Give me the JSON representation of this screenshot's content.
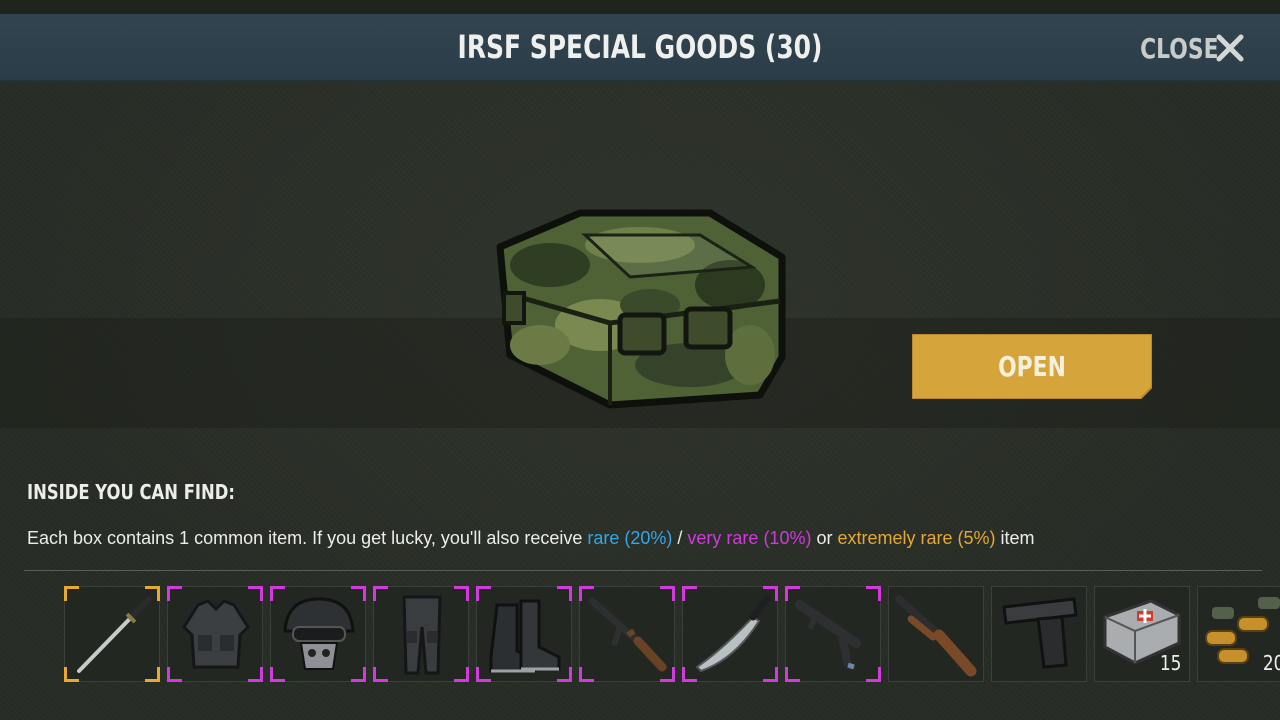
{
  "header": {
    "title": "IRSF SPECIAL GOODS (30)",
    "close_label": "CLOSE"
  },
  "crate": {
    "icon": "camo-crate-icon"
  },
  "open_button": {
    "label": "OPEN"
  },
  "contents": {
    "heading": "INSIDE YOU CAN FIND:",
    "description": {
      "intro": "Each box contains 1 common item. If you get lucky, you'll also receive ",
      "rare": "rare (20%)",
      "sep1": " / ",
      "very_rare": "very rare (10%)",
      "sep2": " or ",
      "extremely_rare": "extremely rare (5%)",
      "outro": " item"
    }
  },
  "colors": {
    "selected": "#e8a92e",
    "very_rare": "#d13adc",
    "rare": "#35a6e6",
    "extremely_rare": "#e4a934",
    "header": "#2e404b",
    "button": "#d5a43a"
  },
  "items": [
    {
      "icon": "katana-icon",
      "rarity": "selected",
      "qty": ""
    },
    {
      "icon": "tactical-vest-icon",
      "rarity": "very_rare",
      "qty": ""
    },
    {
      "icon": "helmet-mask-icon",
      "rarity": "very_rare",
      "qty": ""
    },
    {
      "icon": "tactical-pants-icon",
      "rarity": "very_rare",
      "qty": ""
    },
    {
      "icon": "combat-boots-icon",
      "rarity": "very_rare",
      "qty": ""
    },
    {
      "icon": "assault-rifle-icon",
      "rarity": "very_rare",
      "qty": ""
    },
    {
      "icon": "machete-icon",
      "rarity": "very_rare",
      "qty": ""
    },
    {
      "icon": "smg-icon",
      "rarity": "very_rare",
      "qty": ""
    },
    {
      "icon": "sawed-off-shotgun-icon",
      "rarity": "common",
      "qty": ""
    },
    {
      "icon": "pistol-icon",
      "rarity": "common",
      "qty": ""
    },
    {
      "icon": "medkit-icon",
      "rarity": "common",
      "qty": "15"
    },
    {
      "icon": "ammo-icon",
      "rarity": "common",
      "qty": "20"
    }
  ]
}
